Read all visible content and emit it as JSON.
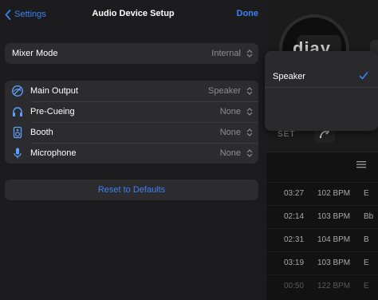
{
  "nav": {
    "back_label": "Settings",
    "title": "Audio Device Setup",
    "done_label": "Done"
  },
  "mixer": {
    "label": "Mixer Mode",
    "value": "Internal"
  },
  "outputs": [
    {
      "label": "Main Output",
      "value": "Speaker",
      "icon": "audio-output-icon"
    },
    {
      "label": "Pre-Cueing",
      "value": "None",
      "icon": "headphones-icon"
    },
    {
      "label": "Booth",
      "value": "None",
      "icon": "speaker-icon"
    },
    {
      "label": "Microphone",
      "value": "None",
      "icon": "microphone-icon"
    }
  ],
  "reset_label": "Reset to Defaults",
  "popover": {
    "options": [
      {
        "label": "Speaker",
        "selected": true
      }
    ]
  },
  "background_app": {
    "logo": "djay",
    "set_label": "SET",
    "tracks": [
      {
        "time": "03:27",
        "bpm": "102 BPM",
        "key": "E"
      },
      {
        "time": "02:14",
        "bpm": "103 BPM",
        "key": "Bb"
      },
      {
        "time": "02:31",
        "bpm": "104 BPM",
        "key": "B"
      },
      {
        "time": "03:19",
        "bpm": "103 BPM",
        "key": "E"
      },
      {
        "time": "00:50",
        "bpm": "122 BPM",
        "key": "E"
      }
    ]
  },
  "colors": {
    "accent": "#3b82f6",
    "sheet_bg": "#1c1c1e",
    "group_bg": "#2c2c2e",
    "secondary_text": "#8e8e93"
  }
}
